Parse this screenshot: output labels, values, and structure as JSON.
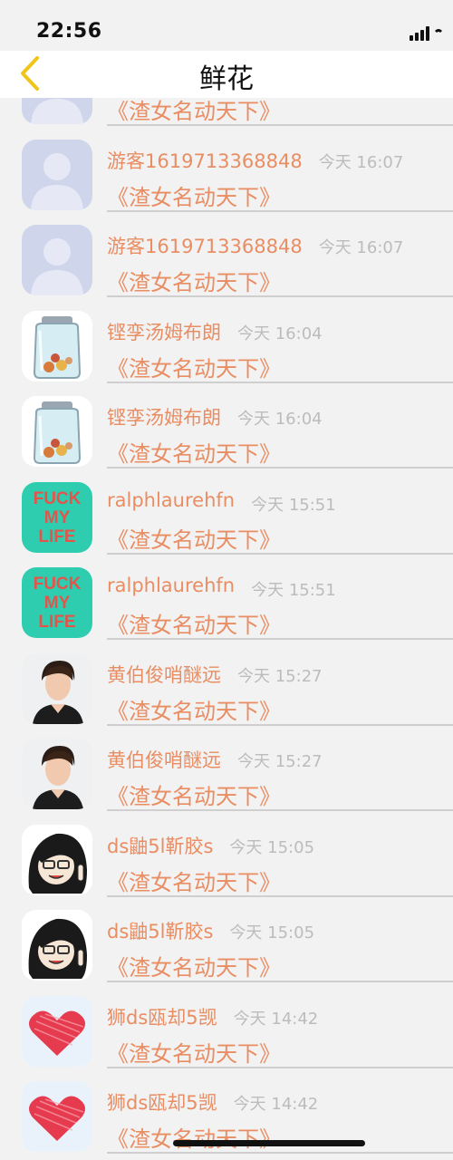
{
  "status_bar": {
    "time": "22:56"
  },
  "nav": {
    "title": "鲜花",
    "back_icon": "chevron-left-icon",
    "accent": "#f0c419"
  },
  "colors": {
    "name": "#e98d63",
    "time": "#bcbcbc",
    "divider": "#cfcfcf"
  },
  "rows": [
    {
      "name": "",
      "time": "",
      "book": "《渣女名动天下》",
      "avatar": "default-person-avatar"
    },
    {
      "name": "游客1619713368848",
      "time": "今天 16:07",
      "book": "《渣女名动天下》",
      "avatar": "default-person-avatar"
    },
    {
      "name": "游客1619713368848",
      "time": "今天 16:07",
      "book": "《渣女名动天下》",
      "avatar": "default-person-avatar"
    },
    {
      "name": "铿孪汤姆布朗",
      "time": "今天 16:04",
      "book": "《渣女名动天下》",
      "avatar": "glass-jar-avatar"
    },
    {
      "name": "铿孪汤姆布朗",
      "time": "今天 16:04",
      "book": "《渣女名动天下》",
      "avatar": "glass-jar-avatar"
    },
    {
      "name": "ralphlaurehfn",
      "time": "今天 15:51",
      "book": "《渣女名动天下》",
      "avatar": "text-avatar",
      "avatar_text": [
        "FUCK",
        "MY",
        "LIFE"
      ]
    },
    {
      "name": "ralphlaurehfn",
      "time": "今天 15:51",
      "book": "《渣女名动天下》",
      "avatar": "text-avatar",
      "avatar_text": [
        "FUCK",
        "MY",
        "LIFE"
      ]
    },
    {
      "name": "黄伯俊哨醚远",
      "time": "今天 15:27",
      "book": "《渣女名动天下》",
      "avatar": "portrait-avatar"
    },
    {
      "name": "黄伯俊哨醚远",
      "time": "今天 15:27",
      "book": "《渣女名动天下》",
      "avatar": "portrait-avatar"
    },
    {
      "name": "ds鼬5l靳胶s",
      "time": "今天 15:05",
      "book": "《渣女名动天下》",
      "avatar": "cartoon-avatar"
    },
    {
      "name": "ds鼬5l靳胶s",
      "time": "今天 15:05",
      "book": "《渣女名动天下》",
      "avatar": "cartoon-avatar"
    },
    {
      "name": "狮ds瓯却5觊",
      "time": "今天 14:42",
      "book": "《渣女名动天下》",
      "avatar": "heart-avatar"
    },
    {
      "name": "狮ds瓯却5觊",
      "time": "今天 14:42",
      "book": "《渣女名动天下》",
      "avatar": "heart-avatar"
    }
  ]
}
